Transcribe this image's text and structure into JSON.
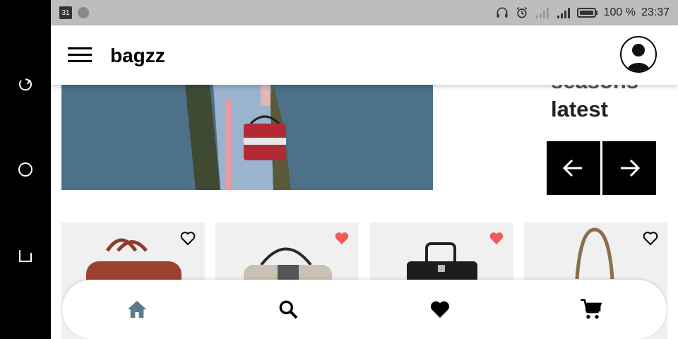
{
  "status_bar": {
    "calendar_day": "31",
    "battery_text": "100 %",
    "time": "23:37",
    "icons": [
      "calendar-icon",
      "notification-dot-icon",
      "headphones-icon",
      "alarm-icon",
      "signal-weak-icon",
      "signal-icon",
      "battery-icon"
    ]
  },
  "nav_strip": {
    "icons": [
      "back-icon",
      "home-circle-icon",
      "recents-icon"
    ]
  },
  "app_bar": {
    "title": "bagzz",
    "menu_icon": "hamburger-menu-icon",
    "avatar_icon": "user-avatar-icon"
  },
  "hero": {
    "line1": "seasons",
    "line2": "latest",
    "prev_icon": "arrow-left-icon",
    "next_icon": "arrow-right-icon"
  },
  "products": [
    {
      "name": "bag-1",
      "favorited": false
    },
    {
      "name": "bag-2",
      "favorited": true
    },
    {
      "name": "bag-3",
      "favorited": true
    },
    {
      "name": "bag-4",
      "favorited": false
    }
  ],
  "bottom_nav": {
    "items": [
      "home-icon",
      "search-icon",
      "favorites-icon",
      "cart-icon"
    ],
    "active": "home-icon"
  },
  "colors": {
    "accent_home": "#5d7a8c",
    "heart_active": "#f15a5a",
    "hero_bg": "#4d7189",
    "card_bg": "#f0f0f0",
    "status_bar_bg": "#bdbdbd"
  }
}
